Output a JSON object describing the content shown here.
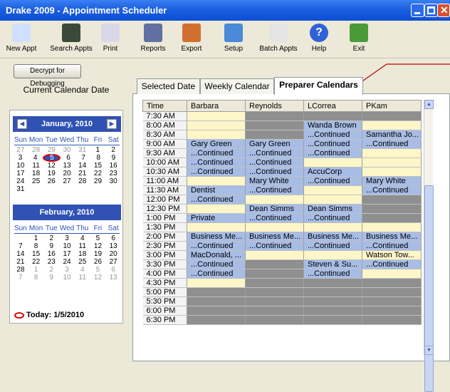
{
  "window": {
    "title": "Drake 2009 - Appointment Scheduler"
  },
  "toolbar": {
    "items": [
      {
        "label": "New Appt",
        "icon": "new-appointment-icon"
      },
      {
        "label": "Search Appts",
        "icon": "binoculars-icon"
      },
      {
        "label": "Print",
        "icon": "printer-icon"
      },
      {
        "label": "Reports",
        "icon": "reports-icon"
      },
      {
        "label": "Export",
        "icon": "export-icon"
      },
      {
        "label": "Setup",
        "icon": "setup-icon"
      },
      {
        "label": "Batch Appts",
        "icon": "calendar-icon"
      },
      {
        "label": "Help",
        "icon": "help-icon"
      },
      {
        "label": "Exit",
        "icon": "exit-icon"
      }
    ]
  },
  "decrypt_label": "Decrypt for Debugging",
  "calendar": {
    "heading": "Current Calendar Date",
    "dow": [
      "Sun",
      "Mon",
      "Tue",
      "Wed",
      "Thu",
      "Fri",
      "Sat"
    ],
    "jan": {
      "title": "January, 2010",
      "weeks": [
        [
          "27",
          "28",
          "29",
          "30",
          "31",
          "1",
          "2"
        ],
        [
          "3",
          "4",
          "5",
          "6",
          "7",
          "8",
          "9"
        ],
        [
          "10",
          "11",
          "12",
          "13",
          "14",
          "15",
          "16"
        ],
        [
          "17",
          "18",
          "19",
          "20",
          "21",
          "22",
          "23"
        ],
        [
          "24",
          "25",
          "26",
          "27",
          "28",
          "29",
          "30"
        ],
        [
          "31",
          "",
          "",
          "",
          "",
          "",
          ""
        ]
      ]
    },
    "feb": {
      "title": "February, 2010",
      "weeks": [
        [
          "",
          "1",
          "2",
          "3",
          "4",
          "5",
          "6"
        ],
        [
          "7",
          "8",
          "9",
          "10",
          "11",
          "12",
          "13"
        ],
        [
          "14",
          "15",
          "16",
          "17",
          "18",
          "19",
          "20"
        ],
        [
          "21",
          "22",
          "23",
          "24",
          "25",
          "26",
          "27"
        ],
        [
          "28",
          "1",
          "2",
          "3",
          "4",
          "5",
          "6"
        ],
        [
          "7",
          "8",
          "9",
          "10",
          "11",
          "12",
          "13"
        ]
      ]
    },
    "today_label": "Today: 1/5/2010"
  },
  "tabs": [
    "Selected Date",
    "Weekly Calendar",
    "Preparer Calendars"
  ],
  "grid": {
    "headers": [
      "Time",
      "Barbara",
      "Reynolds",
      "LCorrea",
      "PKam"
    ],
    "rows": [
      {
        "time": "7:30 AM",
        "cells": [
          "",
          "",
          "",
          ""
        ]
      },
      {
        "time": "8:00 AM",
        "cells": [
          "",
          "",
          "Wanda Brown",
          ""
        ]
      },
      {
        "time": "8:30 AM",
        "cells": [
          "",
          "",
          "...Continued",
          "Samantha Jo..."
        ]
      },
      {
        "time": "9:00 AM",
        "cells": [
          "Gary Green",
          "Gary Green",
          "...Continued",
          "...Continued"
        ]
      },
      {
        "time": "9:30 AM",
        "cells": [
          "...Continued",
          "...Continued",
          "...Continued",
          ""
        ]
      },
      {
        "time": "10:00 AM",
        "cells": [
          "...Continued",
          "...Continued",
          "",
          ""
        ]
      },
      {
        "time": "10:30 AM",
        "cells": [
          "...Continued",
          "...Continued",
          "AccuCorp",
          ""
        ]
      },
      {
        "time": "11:00 AM",
        "cells": [
          "",
          "Mary White",
          "...Continued",
          "Mary White"
        ]
      },
      {
        "time": "11:30 AM",
        "cells": [
          "Dentist",
          "...Continued",
          "",
          "...Continued"
        ]
      },
      {
        "time": "12:00 PM",
        "cells": [
          "...Continued",
          "",
          "",
          ""
        ]
      },
      {
        "time": "12:30 PM",
        "cells": [
          "",
          "Dean Simms",
          "Dean Simms",
          ""
        ]
      },
      {
        "time": "1:00 PM",
        "cells": [
          "Private",
          "...Continued",
          "...Continued",
          ""
        ]
      },
      {
        "time": "1:30 PM",
        "cells": [
          "",
          "",
          "",
          ""
        ]
      },
      {
        "time": "2:00 PM",
        "cells": [
          "Business Me...",
          "Business Me...",
          "Business Me...",
          "Business Me..."
        ]
      },
      {
        "time": "2:30 PM",
        "cells": [
          "...Continued",
          "...Continued",
          "...Continued",
          "...Continued"
        ]
      },
      {
        "time": "3:00 PM",
        "cells": [
          "MacDonald, ...",
          "",
          "",
          "Watson Tow..."
        ]
      },
      {
        "time": "3:30 PM",
        "cells": [
          "...Continued",
          "",
          "Steven & Su...",
          "...Continued"
        ]
      },
      {
        "time": "4:00 PM",
        "cells": [
          "...Continued",
          "",
          "...Continued",
          ""
        ]
      },
      {
        "time": "4:30 PM",
        "cells": [
          "",
          "",
          "",
          ""
        ]
      },
      {
        "time": "5:00 PM",
        "cells": [
          "",
          "",
          "",
          ""
        ]
      },
      {
        "time": "5:30 PM",
        "cells": [
          "",
          "",
          "",
          ""
        ]
      },
      {
        "time": "6:00 PM",
        "cells": [
          "",
          "",
          "",
          ""
        ]
      },
      {
        "time": "6:30 PM",
        "cells": [
          "",
          "",
          "",
          ""
        ]
      }
    ]
  },
  "colors": {
    "busy": "#a7bde6",
    "free": "#fdf6c8",
    "unavailable": "#8f8f8f",
    "title": "#1c5fe0",
    "accent": "#2f52b4"
  }
}
